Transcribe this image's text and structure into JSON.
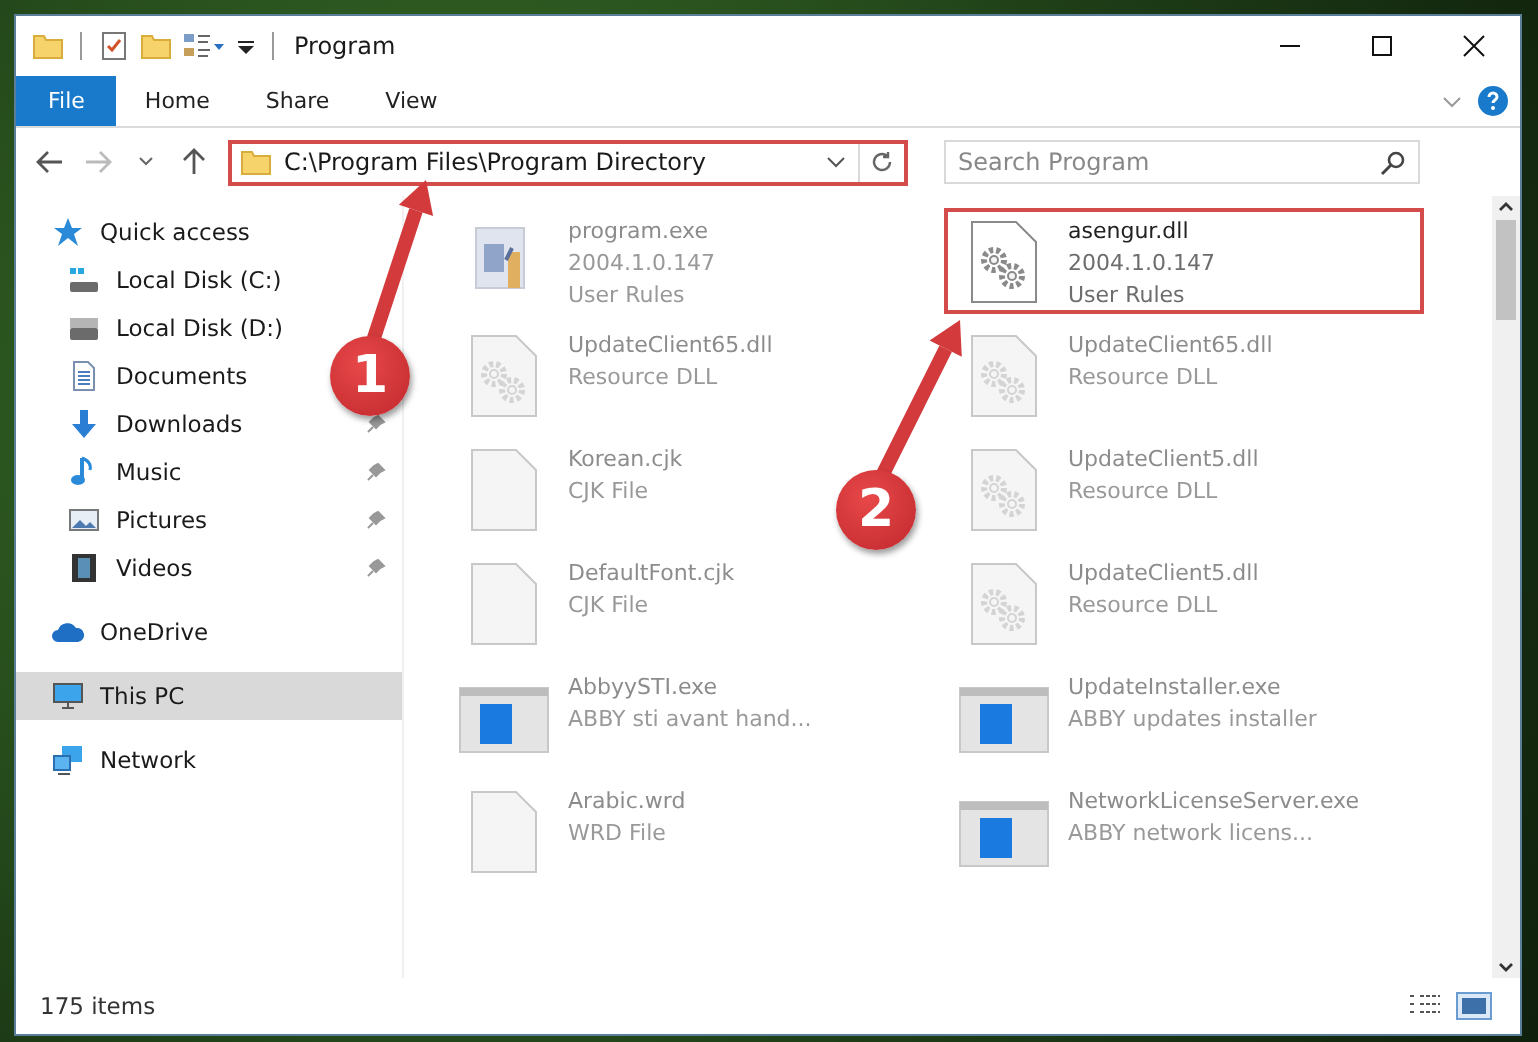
{
  "window": {
    "title": "Program"
  },
  "ribbon": {
    "tabs": [
      {
        "label": "File",
        "kind": "file"
      },
      {
        "label": "Home",
        "kind": "tab"
      },
      {
        "label": "Share",
        "kind": "tab"
      },
      {
        "label": "View",
        "kind": "tab"
      }
    ]
  },
  "address_bar": {
    "path": "C:\\Program Files\\Program Directory",
    "highlighted": true
  },
  "search": {
    "placeholder": "Search Program"
  },
  "sidebar": {
    "items": [
      {
        "label": "Quick access",
        "kind": "quick",
        "pinned": false,
        "selected": false,
        "children": [
          {
            "label": "Local Disk (C:)",
            "kind": "sysdisk",
            "pinned": false,
            "selected": false
          },
          {
            "label": "Local Disk (D:)",
            "kind": "disk",
            "pinned": false,
            "selected": false
          },
          {
            "label": "Documents",
            "kind": "documents",
            "pinned": false,
            "selected": false
          },
          {
            "label": "Downloads",
            "kind": "downloads",
            "pinned": true,
            "selected": false
          },
          {
            "label": "Music",
            "kind": "music",
            "pinned": true,
            "selected": false
          },
          {
            "label": "Pictures",
            "kind": "pictures",
            "pinned": true,
            "selected": false
          },
          {
            "label": "Videos",
            "kind": "videos",
            "pinned": true,
            "selected": false
          }
        ]
      },
      {
        "label": "OneDrive",
        "kind": "cloud",
        "pinned": false,
        "selected": false
      },
      {
        "label": "This PC",
        "kind": "pc",
        "pinned": false,
        "selected": true
      },
      {
        "label": "Network",
        "kind": "network",
        "pinned": false,
        "selected": false
      }
    ]
  },
  "files": [
    {
      "name": "program.exe",
      "lines": [
        "2004.1.0.147",
        "User Rules"
      ],
      "kind": "program",
      "dimmed": true,
      "highlighted": false
    },
    {
      "name": "asengur.dll",
      "lines": [
        "2004.1.0.147",
        "User Rules"
      ],
      "kind": "settings",
      "dimmed": false,
      "highlighted": true
    },
    {
      "name": "UpdateClient65.dll",
      "lines": [
        "Resource DLL"
      ],
      "kind": "dll",
      "dimmed": true,
      "highlighted": false
    },
    {
      "name": "UpdateClient65.dll",
      "lines": [
        "Resource DLL"
      ],
      "kind": "dll",
      "dimmed": true,
      "highlighted": false
    },
    {
      "name": "Korean.cjk",
      "lines": [
        "CJK File"
      ],
      "kind": "document",
      "dimmed": true,
      "highlighted": false
    },
    {
      "name": "UpdateClient5.dll",
      "lines": [
        "Resource DLL"
      ],
      "kind": "dll",
      "dimmed": true,
      "highlighted": false
    },
    {
      "name": "DefaultFont.cjk",
      "lines": [
        "CJK File"
      ],
      "kind": "document",
      "dimmed": true,
      "highlighted": false
    },
    {
      "name": "UpdateClient5.dll",
      "lines": [
        "Resource DLL"
      ],
      "kind": "dll",
      "dimmed": true,
      "highlighted": false
    },
    {
      "name": "AbbyySTI.exe",
      "lines": [
        "ABBY sti avant hand..."
      ],
      "kind": "app",
      "dimmed": true,
      "highlighted": false
    },
    {
      "name": "UpdateInstaller.exe",
      "lines": [
        "ABBY updates installer"
      ],
      "kind": "app",
      "dimmed": true,
      "highlighted": false
    },
    {
      "name": "Arabic.wrd",
      "lines": [
        "WRD File"
      ],
      "kind": "document",
      "dimmed": true,
      "highlighted": false
    },
    {
      "name": "NetworkLicenseServer.exe",
      "lines": [
        "ABBY network licens..."
      ],
      "kind": "app",
      "dimmed": true,
      "highlighted": false
    }
  ],
  "status_bar": {
    "item_count": "175 items"
  },
  "callouts": [
    {
      "number": "1"
    },
    {
      "number": "2"
    }
  ]
}
